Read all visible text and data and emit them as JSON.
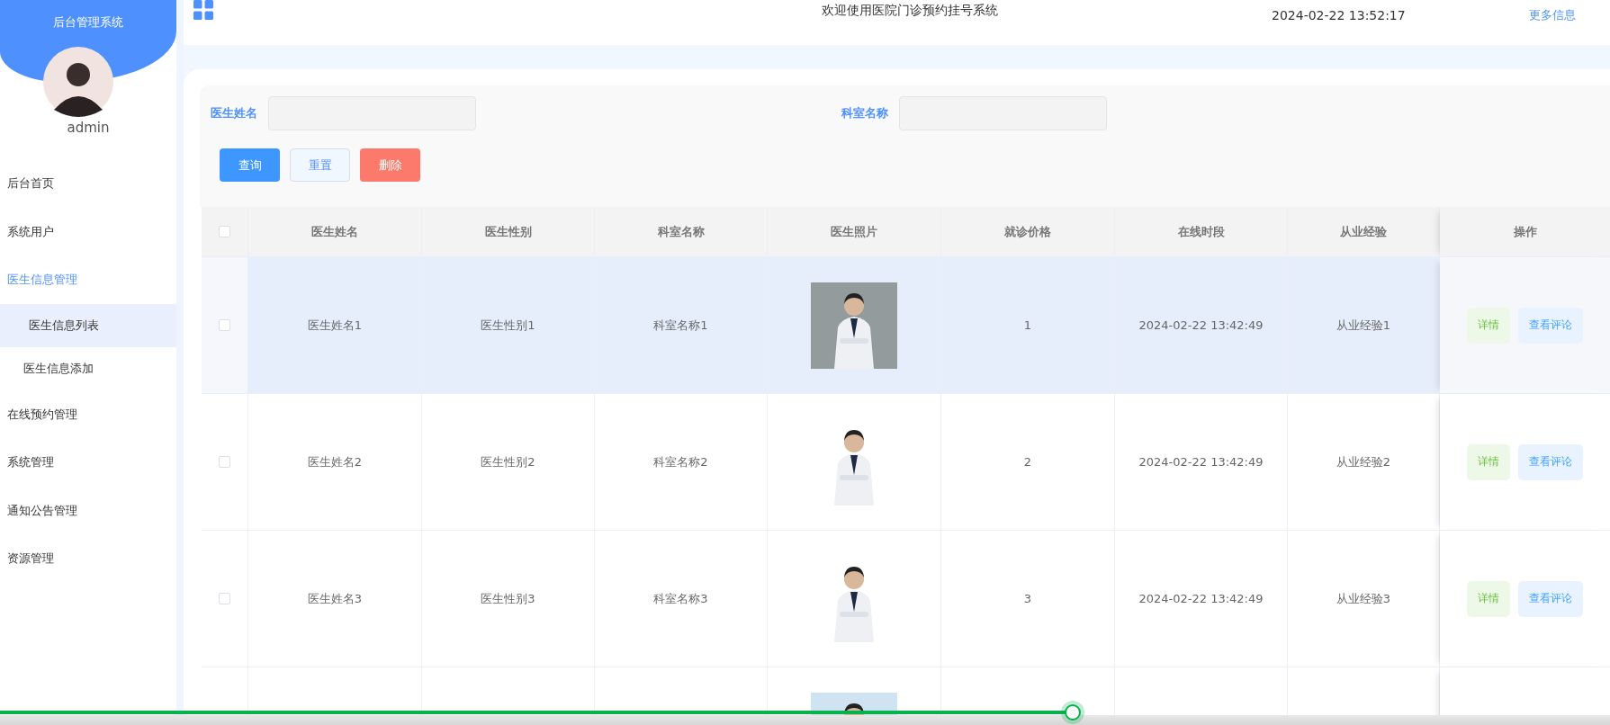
{
  "sidebar": {
    "title": "后台管理系统",
    "user": "admin",
    "menu": [
      {
        "label": "后台首页",
        "selected": false,
        "expanded": false
      },
      {
        "label": "系统用户",
        "selected": false,
        "expanded": false
      },
      {
        "label": "医生信息管理",
        "selected": false,
        "expanded": true,
        "children": [
          {
            "label": "医生信息列表",
            "selected": true
          },
          {
            "label": "医生信息添加",
            "selected": false
          }
        ]
      },
      {
        "label": "在线预约管理",
        "selected": false,
        "expanded": false
      },
      {
        "label": "系统管理",
        "selected": false,
        "expanded": false
      },
      {
        "label": "通知公告管理",
        "selected": false,
        "expanded": false
      },
      {
        "label": "资源管理",
        "selected": false,
        "expanded": false
      }
    ]
  },
  "topbar": {
    "title": "欢迎使用医院门诊预约挂号系统",
    "time": "2024-02-22 13:52:17",
    "link": "更多信息"
  },
  "search": {
    "fields": [
      {
        "label": "医生姓名"
      },
      {
        "label": "科室名称"
      }
    ],
    "buttons": [
      {
        "label": "查询",
        "kind": "primary"
      },
      {
        "label": "重置",
        "kind": "plain"
      },
      {
        "label": "删除",
        "kind": "danger"
      }
    ]
  },
  "table": {
    "header_checked": false,
    "columns": [
      "医生姓名",
      "医生性别",
      "科室名称",
      "医生照片",
      "就诊价格",
      "在线时段",
      "从业经验",
      "操作"
    ],
    "rows": [
      {
        "checked": false,
        "highlighted": true,
        "cells": [
          "医生姓名1",
          "医生性别1",
          "科室名称1",
          {
            "kind": "picture"
          },
          "1",
          "2024-02-22 13:42:49",
          "从业经验1"
        ],
        "actions": [
          "详情",
          "查看评论"
        ]
      },
      {
        "checked": false,
        "highlighted": false,
        "cells": [
          "医生姓名2",
          "医生性别2",
          "科室名称2",
          {
            "kind": "picture"
          },
          "2",
          "2024-02-22 13:42:49",
          "从业经验2"
        ],
        "actions": [
          "详情",
          "查看评论"
        ]
      },
      {
        "checked": false,
        "highlighted": false,
        "cells": [
          "医生姓名3",
          "医生性别3",
          "科室名称3",
          {
            "kind": "picture"
          },
          "3",
          "2024-02-22 13:42:49",
          "从业经验3"
        ],
        "actions": [
          "详情",
          "查看评论"
        ]
      },
      {
        "cells": [
          null,
          null,
          null,
          {
            "kind": "picture"
          }
        ]
      }
    ]
  },
  "video_progress": {
    "level": 0.67
  }
}
